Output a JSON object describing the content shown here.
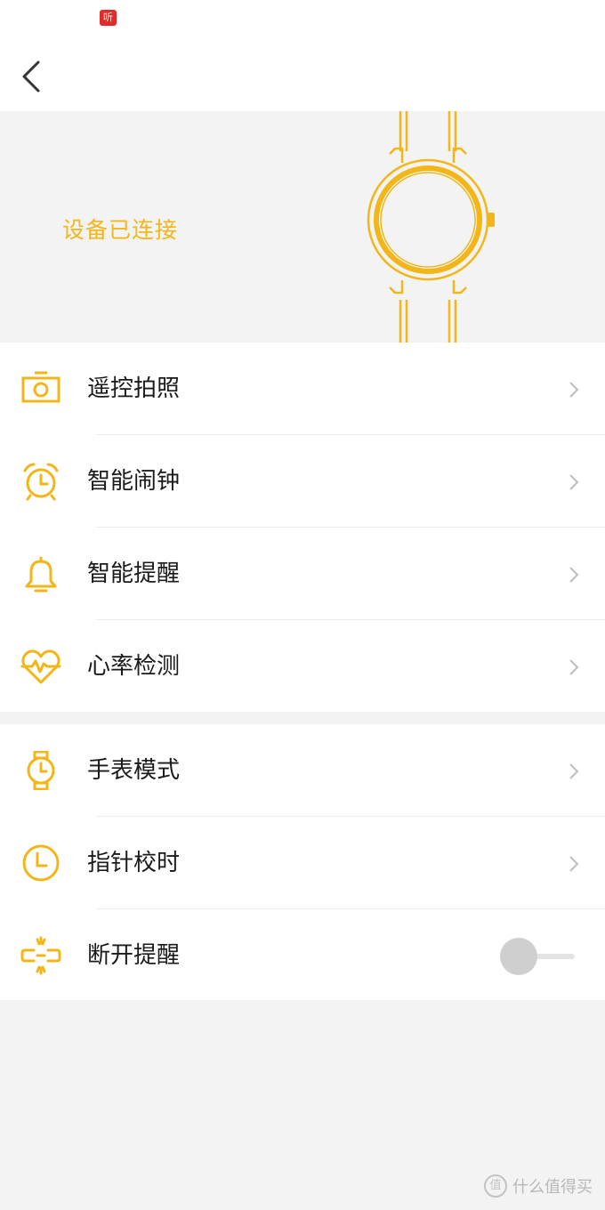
{
  "status_bar": {
    "badge": "听"
  },
  "header": {
    "back": "back"
  },
  "hero": {
    "status_text": "设备已连接",
    "accent": "#f2b619"
  },
  "groups": [
    {
      "items": [
        {
          "label": "遥控拍照",
          "icon": "camera-icon"
        },
        {
          "label": "智能闹钟",
          "icon": "alarm-clock-icon"
        },
        {
          "label": "智能提醒",
          "icon": "bell-icon"
        },
        {
          "label": "心率检测",
          "icon": "heart-rate-icon"
        }
      ]
    },
    {
      "items": [
        {
          "label": "手表模式",
          "icon": "watch-icon"
        },
        {
          "label": "指针校时",
          "icon": "clock-icon"
        },
        {
          "label": "断开提醒",
          "icon": "disconnect-icon",
          "toggle": "off"
        }
      ]
    }
  ],
  "watermark": {
    "text": "什么值得买",
    "logo": "值"
  }
}
